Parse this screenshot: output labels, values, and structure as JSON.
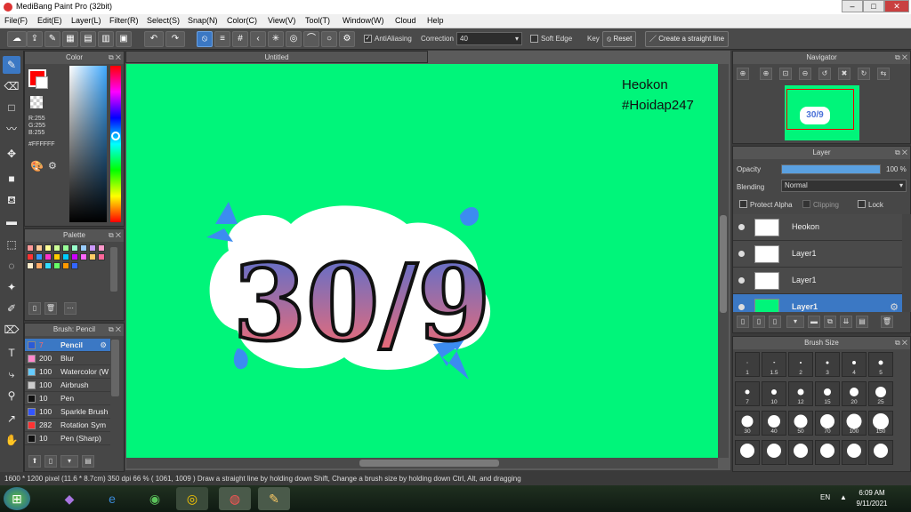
{
  "window": {
    "title": "MediBang Paint Pro (32bit)",
    "minimize": "–",
    "maximize": "□",
    "close": "✕"
  },
  "menu": [
    "File(F)",
    "Edit(E)",
    "Layer(L)",
    "Filter(R)",
    "Select(S)",
    "Snap(N)",
    "Color(C)",
    "View(V)",
    "Tool(T)",
    "Window(W)",
    "Cloud",
    "Help"
  ],
  "toolbar": {
    "antialiasing_label": "AntiAliasing",
    "correction_label": "Correction",
    "correction_value": "40",
    "soft_edge_label": "Soft Edge",
    "key_label": "Key",
    "reset_label": "Reset",
    "straight_line_label": "Create a straight line"
  },
  "color_panel": {
    "title": "Color",
    "r": "R:255",
    "g": "G:255",
    "b": "B:255",
    "hex": "#FFFFFF",
    "primary": "#ff0000",
    "secondary": "#ffffff"
  },
  "palette_panel": {
    "title": "Palette",
    "colors": [
      "#ff9999",
      "#ffcc99",
      "#ffff99",
      "#ccff99",
      "#99ff99",
      "#99ffcc",
      "#99ccff",
      "#cc99ff",
      "#ff99cc",
      "#ff3333",
      "#3399ff",
      "#ff33cc",
      "#ffcc00",
      "#00ccff",
      "#cc00ff",
      "#ff66ff",
      "#ffcc66",
      "#ff6699",
      "#ffeecc",
      "#ffaa66",
      "#33ddff",
      "#66ff66",
      "#ff9900",
      "#3366ff"
    ]
  },
  "brush_panel": {
    "title": "Brush: Pencil",
    "brushes": [
      {
        "size": "7",
        "name": "Pencil",
        "color": "#2a5bd7"
      },
      {
        "size": "200",
        "name": "Blur",
        "color": "#ff88cc"
      },
      {
        "size": "100",
        "name": "Watercolor (W",
        "color": "#66ccff"
      },
      {
        "size": "100",
        "name": "Airbrush",
        "color": "#cccccc"
      },
      {
        "size": "10",
        "name": "Pen",
        "color": "#111111"
      },
      {
        "size": "100",
        "name": "Sparkle Brush",
        "color": "#3355ff"
      },
      {
        "size": "282",
        "name": "Rotation Sym",
        "color": "#ff3333"
      },
      {
        "size": "10",
        "name": "Pen (Sharp)",
        "color": "#111111"
      }
    ]
  },
  "document": {
    "tab_title": "Untitled"
  },
  "canvas": {
    "text_line1": "Heokon",
    "text_line2": "#Hoidap247",
    "art_text": "30/9",
    "bg_color": "#00f57a"
  },
  "navigator": {
    "title": "Navigator"
  },
  "layer_panel": {
    "title": "Layer",
    "opacity_label": "Opacity",
    "opacity_value": "100 %",
    "opacity_fraction": 1.0,
    "blending_label": "Blending",
    "blending_value": "Normal",
    "protect_alpha": "Protect Alpha",
    "clipping": "Clipping",
    "lock": "Lock",
    "layers": [
      {
        "name": "Heokon",
        "selected": false
      },
      {
        "name": "Layer1",
        "selected": false
      },
      {
        "name": "Layer1",
        "selected": false
      },
      {
        "name": "Layer1",
        "selected": true
      }
    ]
  },
  "brush_size_panel": {
    "title": "Brush Size",
    "sizes": [
      "1",
      "1.5",
      "2",
      "3",
      "4",
      "5",
      "7",
      "10",
      "12",
      "15",
      "20",
      "25",
      "30",
      "40",
      "50",
      "70",
      "100",
      "150",
      "",
      "",
      "",
      "",
      "",
      ""
    ]
  },
  "status": {
    "text": "1600 * 1200 pixel   (11.6 * 8.7cm)   350 dpi   66 %   ( 1061, 1009 )   Draw a straight line by holding down Shift, Change a brush size by holding down Ctrl, Alt, and dragging"
  },
  "taskbar": {
    "lang": "EN",
    "time": "6:09 AM",
    "date": "9/11/2021"
  }
}
